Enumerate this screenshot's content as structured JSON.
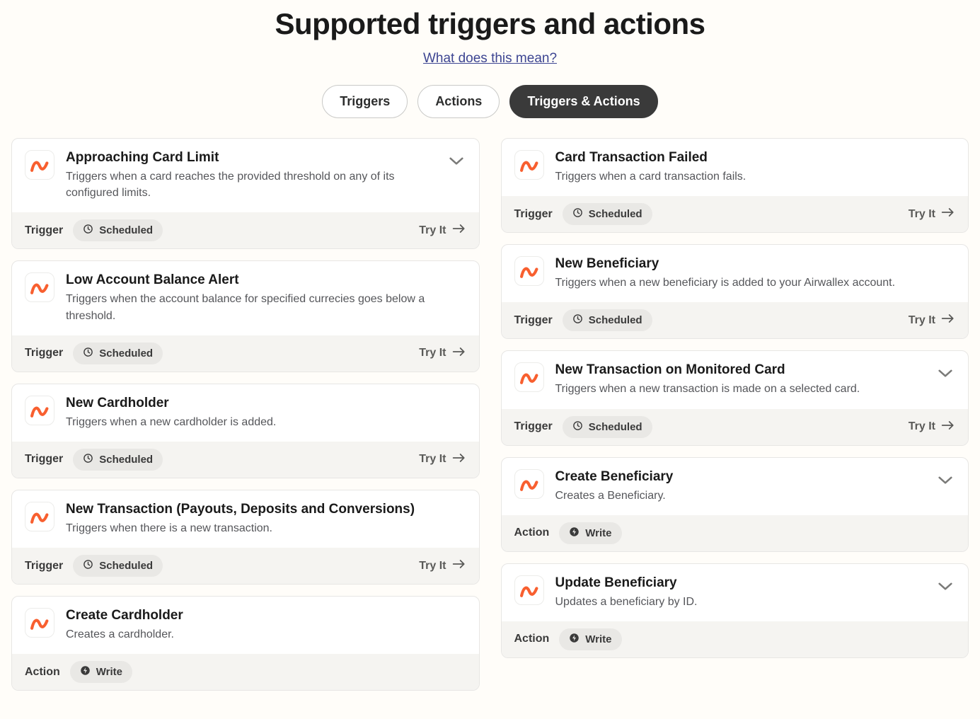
{
  "header": {
    "title": "Supported triggers and actions",
    "explain_link": "What does this mean?"
  },
  "tabs": {
    "triggers": "Triggers",
    "actions": "Actions",
    "both": "Triggers & Actions"
  },
  "labels": {
    "trigger": "Trigger",
    "action": "Action",
    "scheduled": "Scheduled",
    "write": "Write",
    "try_it": "Try It"
  },
  "cards": {
    "left": [
      {
        "title": "Approaching Card Limit",
        "desc": "Triggers when a card reaches the        provided threshold on any of its configured limits.",
        "type": "trigger",
        "mode": "scheduled",
        "chevron": true,
        "tryit": true
      },
      {
        "title": "Low Account Balance Alert",
        "desc": "Triggers when the account balance for specified currecies goes below a threshold.",
        "type": "trigger",
        "mode": "scheduled",
        "chevron": false,
        "tryit": true
      },
      {
        "title": "New Cardholder",
        "desc": "Triggers when a new cardholder is added.",
        "type": "trigger",
        "mode": "scheduled",
        "chevron": false,
        "tryit": true
      },
      {
        "title": "New Transaction (Payouts, Deposits and Conversions)",
        "desc": "Triggers when there is a new transaction.",
        "type": "trigger",
        "mode": "scheduled",
        "chevron": false,
        "tryit": true
      },
      {
        "title": "Create Cardholder",
        "desc": "Creates a cardholder.",
        "type": "action",
        "mode": "write",
        "chevron": false,
        "tryit": false
      }
    ],
    "right": [
      {
        "title": "Card Transaction Failed",
        "desc": "Triggers when a card transaction fails.",
        "type": "trigger",
        "mode": "scheduled",
        "chevron": false,
        "tryit": true
      },
      {
        "title": "New Beneficiary",
        "desc": "Triggers when a new beneficiary is added to your Airwallex account.",
        "type": "trigger",
        "mode": "scheduled",
        "chevron": false,
        "tryit": true
      },
      {
        "title": "New Transaction on Monitored Card",
        "desc": "Triggers when a new transaction is made on a selected card.",
        "type": "trigger",
        "mode": "scheduled",
        "chevron": true,
        "tryit": true
      },
      {
        "title": "Create Beneficiary",
        "desc": "Creates a Beneficiary.",
        "type": "action",
        "mode": "write",
        "chevron": true,
        "tryit": false
      },
      {
        "title": "Update Beneficiary",
        "desc": "Updates a beneficiary by ID.",
        "type": "action",
        "mode": "write",
        "chevron": true,
        "tryit": false
      }
    ]
  }
}
